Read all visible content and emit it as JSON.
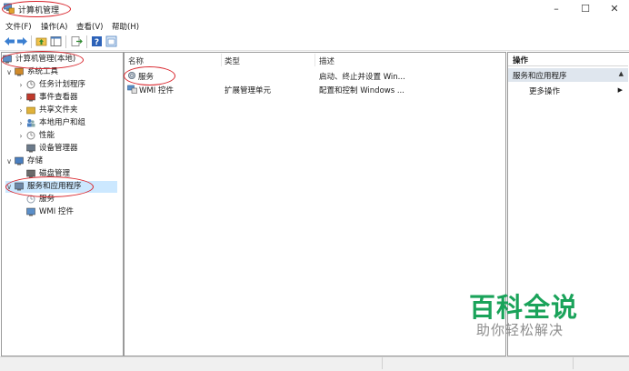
{
  "window": {
    "title": "计算机管理",
    "controls": {
      "minimize": "–",
      "maximize": "☐",
      "close": "✕"
    }
  },
  "menu": [
    "文件(F)",
    "操作(A)",
    "查看(V)",
    "帮助(H)"
  ],
  "tree": [
    {
      "label": "计算机管理(本地)",
      "level": 0,
      "expander": "",
      "icon": "computer-icon"
    },
    {
      "label": "系统工具",
      "level": 1,
      "expander": "∨",
      "icon": "tools-icon"
    },
    {
      "label": "任务计划程序",
      "level": 2,
      "expander": "›",
      "icon": "clock-icon"
    },
    {
      "label": "事件查看器",
      "level": 2,
      "expander": "›",
      "icon": "event-viewer-icon"
    },
    {
      "label": "共享文件夹",
      "level": 2,
      "expander": "›",
      "icon": "shared-folder-icon"
    },
    {
      "label": "本地用户和组",
      "level": 2,
      "expander": "›",
      "icon": "users-icon"
    },
    {
      "label": "性能",
      "level": 2,
      "expander": "›",
      "icon": "performance-icon"
    },
    {
      "label": "设备管理器",
      "level": 2,
      "expander": "",
      "icon": "device-manager-icon"
    },
    {
      "label": "存储",
      "level": 1,
      "expander": "∨",
      "icon": "storage-icon"
    },
    {
      "label": "磁盘管理",
      "level": 2,
      "expander": "",
      "icon": "disk-icon"
    },
    {
      "label": "服务和应用程序",
      "level": 1,
      "expander": "∨",
      "icon": "services-apps-icon"
    },
    {
      "label": "服务",
      "level": 2,
      "expander": "",
      "icon": "services-gear-icon"
    },
    {
      "label": "WMI 控件",
      "level": 2,
      "expander": "",
      "icon": "wmi-icon"
    }
  ],
  "list": {
    "columns": [
      "名称",
      "类型",
      "描述"
    ],
    "rows": [
      {
        "name": "服务",
        "type": "",
        "desc": "启动、终止并设置 Win...",
        "icon": "services-gear-icon"
      },
      {
        "name": "WMI 控件",
        "type": "扩展管理单元",
        "desc": "配置和控制 Windows ...",
        "icon": "wmi-icon"
      }
    ]
  },
  "actions": {
    "header": "操作",
    "section": "服务和应用程序",
    "section_arrow": "▲",
    "items": [
      {
        "label": "更多操作",
        "arrow": "▶"
      }
    ]
  },
  "watermark": {
    "big": "百科全说",
    "small": "助你轻松解决"
  },
  "colors": {
    "selection": "#cce8ff",
    "annotation": "#d8232a",
    "watermark_green": "#1aa35a"
  }
}
